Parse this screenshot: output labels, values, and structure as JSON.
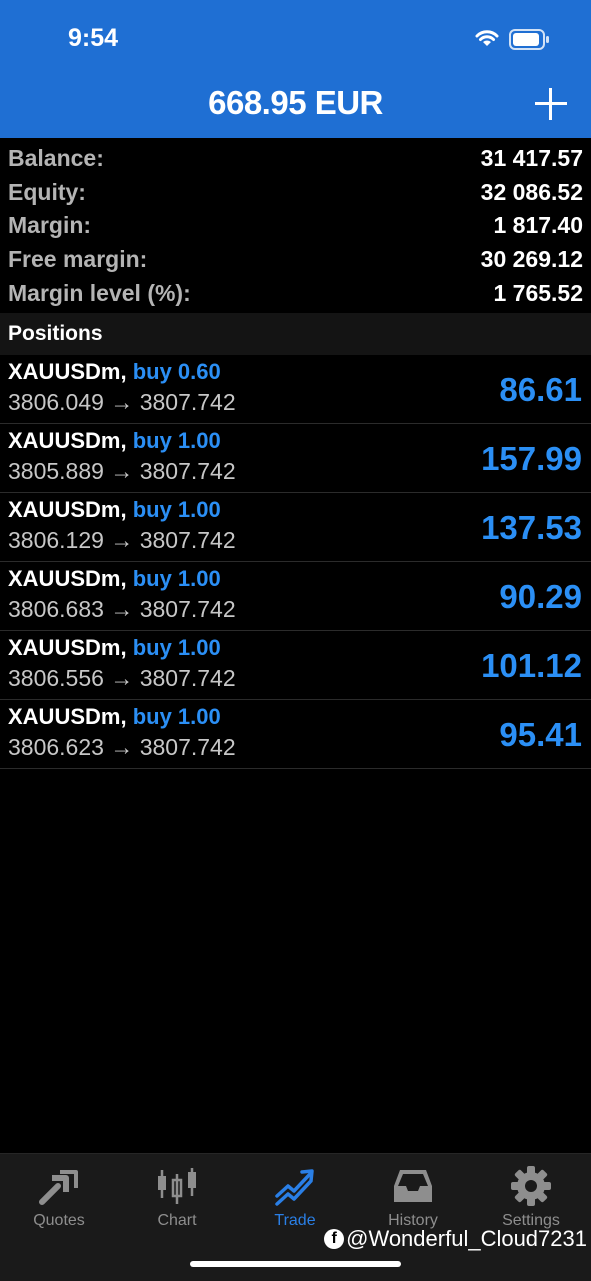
{
  "status_bar": {
    "time": "9:54"
  },
  "header": {
    "title": "668.95 EUR"
  },
  "summary": [
    {
      "label": "Balance:",
      "value": "31 417.57"
    },
    {
      "label": "Equity:",
      "value": "32 086.52"
    },
    {
      "label": "Margin:",
      "value": "1 817.40"
    },
    {
      "label": "Free margin:",
      "value": "30 269.12"
    },
    {
      "label": "Margin level (%):",
      "value": "1 765.52"
    }
  ],
  "positions_header": "Positions",
  "positions": [
    {
      "symbol": "XAUUSDm,",
      "side": "buy 0.60",
      "prices": "3806.049 → 3807.742",
      "profit": "86.61"
    },
    {
      "symbol": "XAUUSDm,",
      "side": "buy 1.00",
      "prices": "3805.889 → 3807.742",
      "profit": "157.99"
    },
    {
      "symbol": "XAUUSDm,",
      "side": "buy 1.00",
      "prices": "3806.129 → 3807.742",
      "profit": "137.53"
    },
    {
      "symbol": "XAUUSDm,",
      "side": "buy 1.00",
      "prices": "3806.683 → 3807.742",
      "profit": "90.29"
    },
    {
      "symbol": "XAUUSDm,",
      "side": "buy 1.00",
      "prices": "3806.556 → 3807.742",
      "profit": "101.12"
    },
    {
      "symbol": "XAUUSDm,",
      "side": "buy 1.00",
      "prices": "3806.623 → 3807.742",
      "profit": "95.41"
    }
  ],
  "tabs": [
    {
      "label": "Quotes",
      "icon": "quotes-icon",
      "active": false
    },
    {
      "label": "Chart",
      "icon": "chart-icon",
      "active": false
    },
    {
      "label": "Trade",
      "icon": "trade-icon",
      "active": true
    },
    {
      "label": "History",
      "icon": "history-icon",
      "active": false
    },
    {
      "label": "Settings",
      "icon": "settings-icon",
      "active": false
    }
  ],
  "watermark": "@Wonderful_Cloud7231",
  "colors": {
    "header": "#1f6fd3",
    "accent": "#2b8ff5",
    "background": "#000000"
  }
}
